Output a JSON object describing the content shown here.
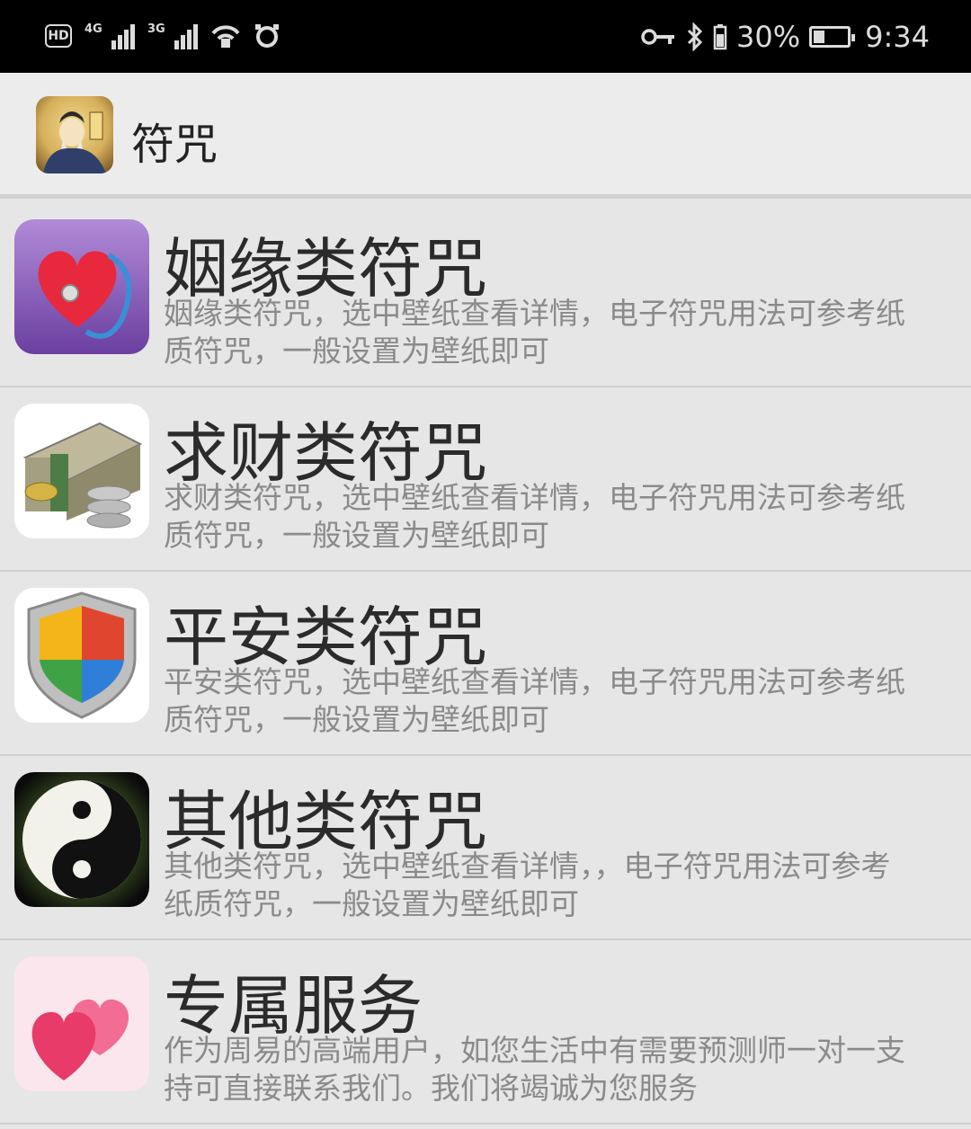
{
  "status_bar": {
    "hd": "HD",
    "network1": "4G",
    "network2": "3G",
    "battery_percent": "30%",
    "time": "9:34"
  },
  "app_bar": {
    "title": "符咒"
  },
  "items": [
    {
      "title": "姻缘类符咒",
      "desc": "姻缘类符咒，选中壁纸查看详情，电子符咒用法可参考纸\n质符咒，一般设置为壁纸即可",
      "icon": "heart-stethoscope-icon"
    },
    {
      "title": "求财类符咒",
      "desc": "求财类符咒，选中壁纸查看详情，电子符咒用法可参考纸\n质符咒，一般设置为壁纸即可",
      "icon": "money-coins-icon"
    },
    {
      "title": "平安类符咒",
      "desc": "平安类符咒，选中壁纸查看详情，电子符咒用法可参考纸\n质符咒，一般设置为壁纸即可",
      "icon": "shield-icon"
    },
    {
      "title": "其他类符咒",
      "desc": "其他类符咒，选中壁纸查看详情，，电子符咒用法可参考\n纸质符咒，一般设置为壁纸即可",
      "icon": "yin-yang-icon"
    },
    {
      "title": "专属服务",
      "desc": "作为周易的高端用户，如您生活中有需要预测师一对一支\n持可直接联系我们。我们将竭诚为您服务",
      "icon": "two-hearts-icon"
    }
  ],
  "colors": {
    "status_bg": "#000000",
    "appbar_bg": "#ececec",
    "list_bg": "#e6e6e6",
    "title_text": "#2b2b2b",
    "desc_text": "#8a8a8a"
  }
}
